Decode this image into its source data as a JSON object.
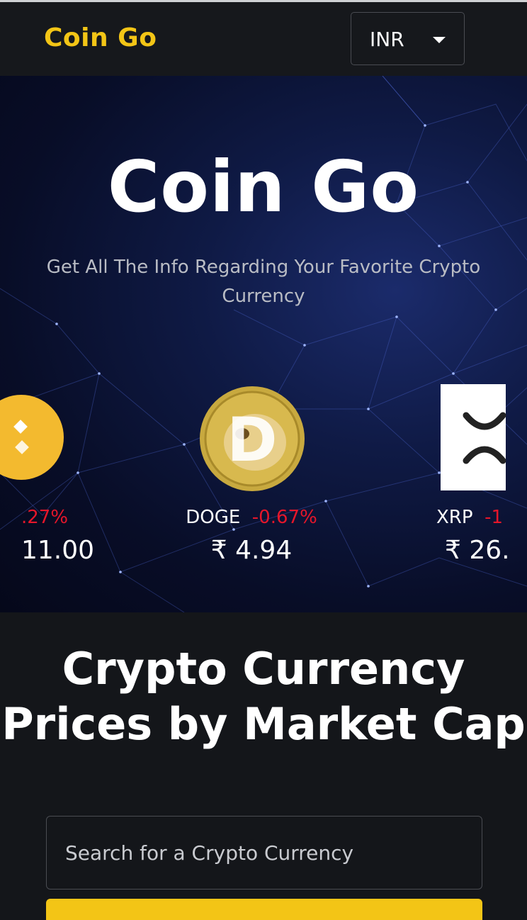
{
  "header": {
    "brand": "Coin Go",
    "currency": "INR"
  },
  "hero": {
    "title": "Coin Go",
    "subtitle": "Get All The Info Regarding Your Favorite Crypto Currency"
  },
  "carousel": [
    {
      "symbol": "",
      "change": ".27%",
      "price": "11.00",
      "icon": "bnb-coin-icon"
    },
    {
      "symbol": "DOGE",
      "change": "-0.67%",
      "price": "₹ 4.94",
      "icon": "doge-coin-icon"
    },
    {
      "symbol": "XRP",
      "change": "-1",
      "price": "₹ 26.",
      "icon": "xrp-coin-icon"
    }
  ],
  "market": {
    "title": "Crypto Currency Prices by Market Cap",
    "search_placeholder": "Search for a Crypto Currency"
  },
  "colors": {
    "accent": "#f3c516",
    "negative": "#e5162a",
    "background": "#14161a"
  }
}
